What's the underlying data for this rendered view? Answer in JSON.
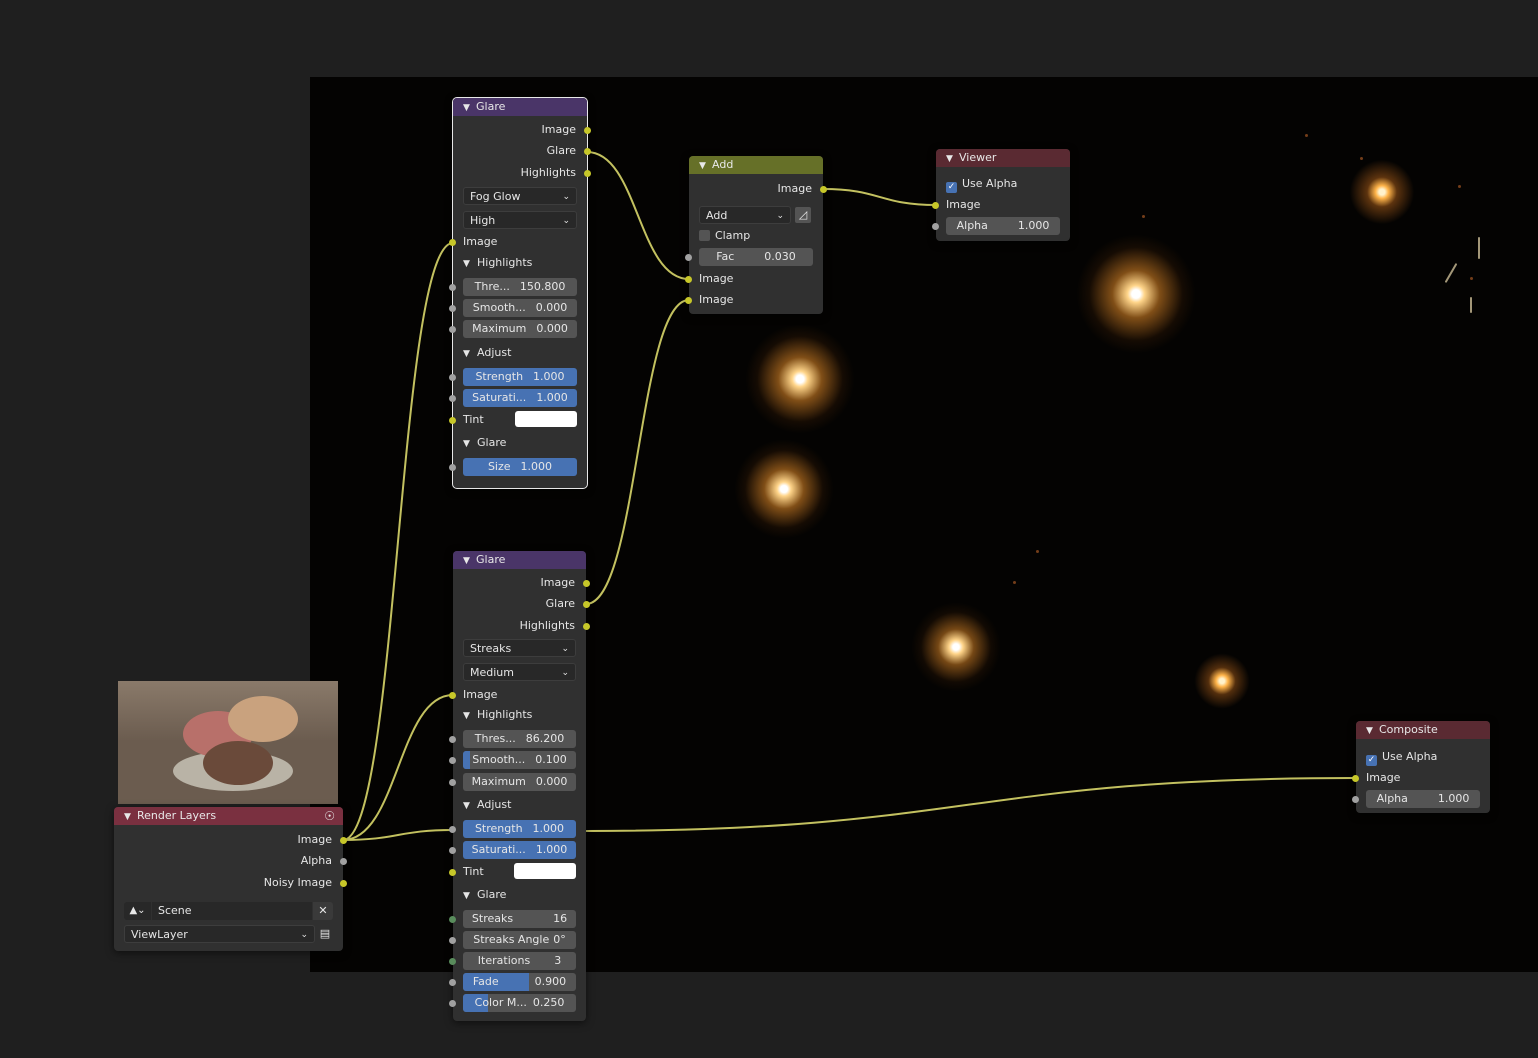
{
  "viewer_alpha": {
    "use_alpha_label": "Use Alpha",
    "image_label": "Image",
    "alpha_label": "Alpha",
    "alpha_value": "1.000"
  },
  "glare1": {
    "title": "Glare",
    "outputs": [
      "Image",
      "Glare",
      "Highlights"
    ],
    "type": "Fog Glow",
    "quality": "High",
    "image_input": "Image",
    "panel_highlights": "Highlights",
    "threshold_label": "Thre...",
    "threshold_value": "150.800",
    "smooth_label": "Smooth...",
    "smooth_value": "0.000",
    "maximum_label": "Maximum",
    "maximum_value": "0.000",
    "panel_adjust": "Adjust",
    "strength_label": "Strength",
    "strength_value": "1.000",
    "saturation_label": "Saturati...",
    "saturation_value": "1.000",
    "tint_label": "Tint",
    "panel_glare": "Glare",
    "size_label": "Size",
    "size_value": "1.000"
  },
  "add": {
    "title": "Add",
    "output": "Image",
    "operation": "Add",
    "clamp_label": "Clamp",
    "fac_label": "Fac",
    "fac_value": "0.030",
    "input1": "Image",
    "input2": "Image"
  },
  "viewer": {
    "title": "Viewer"
  },
  "glare2": {
    "title": "Glare",
    "outputs": [
      "Image",
      "Glare",
      "Highlights"
    ],
    "type": "Streaks",
    "quality": "Medium",
    "image_input": "Image",
    "panel_highlights": "Highlights",
    "threshold_label": "Thres...",
    "threshold_value": "86.200",
    "smooth_label": "Smooth...",
    "smooth_value": "0.100",
    "maximum_label": "Maximum",
    "maximum_value": "0.000",
    "panel_adjust": "Adjust",
    "strength_label": "Strength",
    "strength_value": "1.000",
    "saturation_label": "Saturati...",
    "saturation_value": "1.000",
    "tint_label": "Tint",
    "panel_glare": "Glare",
    "streaks_label": "Streaks",
    "streaks_value": "16",
    "streaks_angle_label": "Streaks Angle",
    "streaks_angle_value": "0°",
    "iterations_label": "Iterations",
    "iterations_value": "3",
    "fade_label": "Fade",
    "fade_value": "0.900",
    "color_mod_label": "Color M...",
    "color_mod_value": "0.250"
  },
  "render_layers": {
    "title": "Render Layers",
    "outputs": [
      "Image",
      "Alpha",
      "Noisy Image"
    ],
    "scene": "Scene",
    "view_layer": "ViewLayer"
  },
  "composite": {
    "title": "Composite"
  },
  "colors": {
    "image_socket": "#c7c729",
    "value_socket": "#a1a1a1",
    "int_socket": "#598c5c",
    "filter_header": "#4a3568",
    "converter_header": "#667028",
    "output_header": "#5a2a32",
    "input_header": "#7a3040",
    "field_active": "#4772b3",
    "link": "#d8d66a"
  }
}
